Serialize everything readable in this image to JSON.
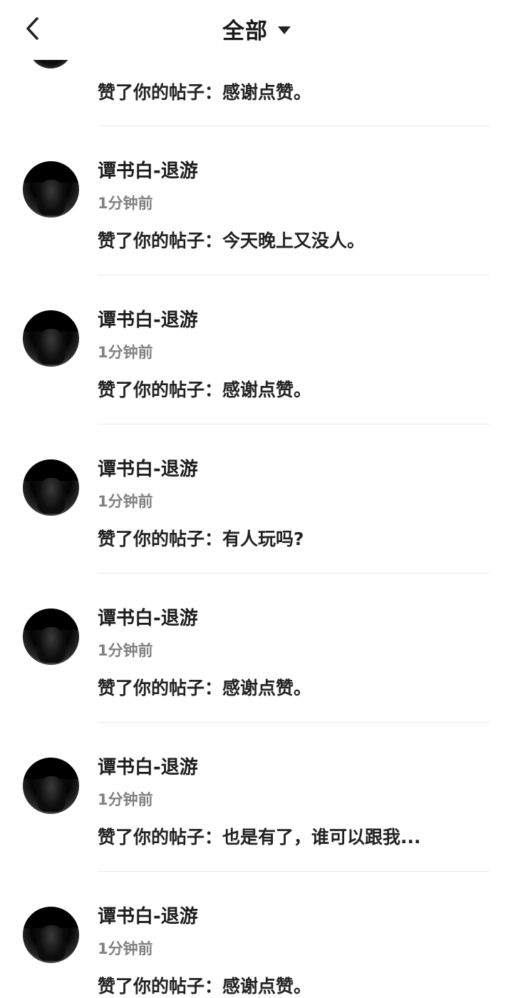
{
  "header": {
    "title": "全部",
    "back_icon": "chevron-left-icon",
    "filter_icon": "caret-down-icon"
  },
  "partial_item": {
    "text": "赞了你的帖子：感谢点赞。"
  },
  "notifications": [
    {
      "name": "谭书白-退游",
      "time": "1分钟前",
      "text": "赞了你的帖子：今天晚上又没人。"
    },
    {
      "name": "谭书白-退游",
      "time": "1分钟前",
      "text": "赞了你的帖子：感谢点赞。"
    },
    {
      "name": "谭书白-退游",
      "time": "1分钟前",
      "text": "赞了你的帖子：有人玩吗?"
    },
    {
      "name": "谭书白-退游",
      "time": "1分钟前",
      "text": "赞了你的帖子：感谢点赞。"
    },
    {
      "name": "谭书白-退游",
      "time": "1分钟前",
      "text": "赞了你的帖子：也是有了，谁可以跟我..."
    },
    {
      "name": "谭书白-退游",
      "time": "1分钟前",
      "text": "赞了你的帖子：感谢点赞。"
    }
  ]
}
